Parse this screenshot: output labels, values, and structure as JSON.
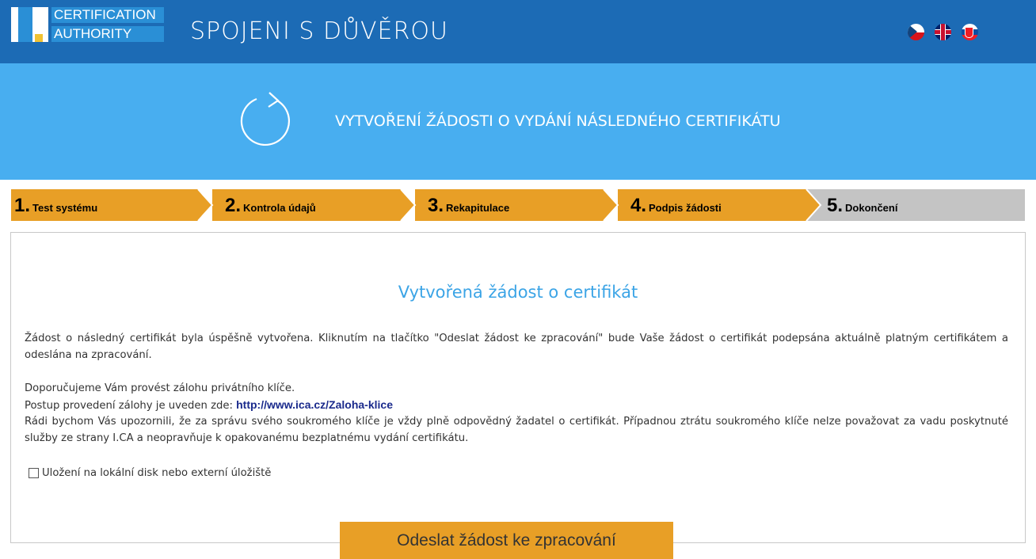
{
  "header": {
    "logo": {
      "mark": "I.",
      "line1": "CERTIFICATION",
      "line2": "AUTHORITY"
    },
    "slogan": "SPOJENI S DŮVĚROU",
    "languages": [
      "cz-flag-icon",
      "uk-flag-icon",
      "sk-flag-icon"
    ]
  },
  "banner": {
    "icon": "refresh-icon",
    "title": "VYTVOŘENÍ ŽÁDOSTI O VYDÁNÍ NÁSLEDNÉHO CERTIFIKÁTU"
  },
  "steps": [
    {
      "num": "1.",
      "label": "Test systému",
      "state": "done"
    },
    {
      "num": "2.",
      "label": "Kontrola údajů",
      "state": "done"
    },
    {
      "num": "3.",
      "label": "Rekapitulace",
      "state": "done"
    },
    {
      "num": "4.",
      "label": "Podpis žádosti",
      "state": "done"
    },
    {
      "num": "5.",
      "label": "Dokončení",
      "state": "active"
    }
  ],
  "content": {
    "title": "Vytvořená žádost o certifikát",
    "para1": "Žádost o následný certifikát byla úspěšně vytvořena. Kliknutím na tlačítko \"Odeslat žádost ke zpracování\" bude Vaše žádost o certifikát podepsána aktuálně platným certifikátem a odeslána na zpracování.",
    "para2_line1": "Doporučujeme Vám provést zálohu privátního klíče.",
    "para2_line2_prefix": "Postup provedení zálohy je uveden zde: ",
    "backup_link": "http://www.ica.cz/Zaloha-klice",
    "para3": "Rádi bychom Vás upozornili, že za správu svého soukromého klíče je vždy plně odpovědný žadatel o certifikát. Případnou ztrátu soukromého klíče nelze považovat za vadu poskytnuté služby ze strany I.CA a neopravňuje k opakovanému bezplatnému vydání certifikátu.",
    "checkbox_label": "Uložení na lokální disk nebo externí úložiště",
    "checkbox_checked": false
  },
  "submit_label": "Odeslat žádost ke zpracování",
  "colors": {
    "header": "#1c6bb5",
    "banner": "#48aef0",
    "accent": "#e89f26",
    "title": "#3ba4e6",
    "inactive": "#c4c4c4"
  }
}
